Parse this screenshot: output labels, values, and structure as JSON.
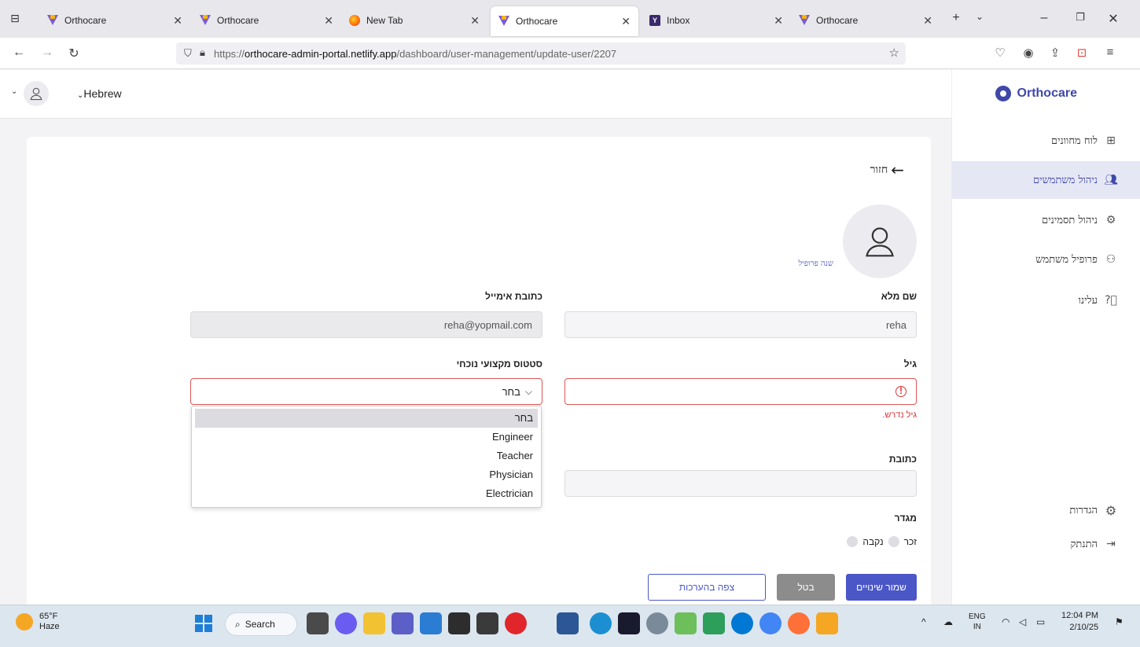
{
  "browser": {
    "tabs": [
      {
        "title": "Orthocare",
        "favicon": "orthocare-icon",
        "active": false
      },
      {
        "title": "Orthocare",
        "favicon": "orthocare-icon",
        "active": false
      },
      {
        "title": "New Tab",
        "favicon": "firefox-icon",
        "active": false
      },
      {
        "title": "Orthocare",
        "favicon": "orthocare-icon",
        "active": true
      },
      {
        "title": "Inbox",
        "favicon": "yopmail-icon",
        "active": false
      },
      {
        "title": "Orthocare",
        "favicon": "orthocare-icon",
        "active": false
      }
    ],
    "url_prefix": "https://",
    "url_host": "orthocare-admin-portal.netlify.app",
    "url_path": "/dashboard/user-management/update-user/2207"
  },
  "topbar": {
    "language": "Hebrew"
  },
  "sidebar": {
    "brand": "Orthocare",
    "items": [
      {
        "label": "לוח מחוונים",
        "icon": "dashboard-grid-icon"
      },
      {
        "label": "ניהול משתמשים",
        "icon": "users-icon",
        "active": true
      },
      {
        "label": "ניהול תסמינים",
        "icon": "gear-icon"
      },
      {
        "label": "פרופיל משתמש",
        "icon": "user-profile-icon"
      },
      {
        "label": "עלינו",
        "icon": "help-icon"
      }
    ],
    "settings": "הגדרות",
    "logout": "התנתק"
  },
  "form": {
    "back": "חזור",
    "change_profile": "שנה פרופיל",
    "full_name_label": "שם מלא",
    "full_name_value": "reha",
    "email_label": "כתובת אימייל",
    "email_value": "reha@yopmail.com",
    "age_label": "גיל",
    "age_error": "גיל נדרש.",
    "status_label": "סטטוס מקצועי נוכחי",
    "status_value": "בחר",
    "status_options": [
      "בחר",
      "Engineer",
      "Teacher",
      "Physician",
      "Electrician"
    ],
    "address_label": "כתובת",
    "gender_label": "מגדר",
    "gender_male": "זכר",
    "gender_female": "נקבה",
    "save": "שמור שינויים",
    "cancel": "בטל",
    "view_changes": "צפה בהערכות"
  },
  "taskbar": {
    "temperature": "65°F",
    "weather": "Haze",
    "search": "Search",
    "lang_top": "ENG",
    "lang_bottom": "IN",
    "time": "12:04 PM",
    "date": "2/10/25"
  },
  "colors": {
    "accent": "#4b57c7",
    "error": "#d33333",
    "active_bg": "#e6e7f5"
  }
}
